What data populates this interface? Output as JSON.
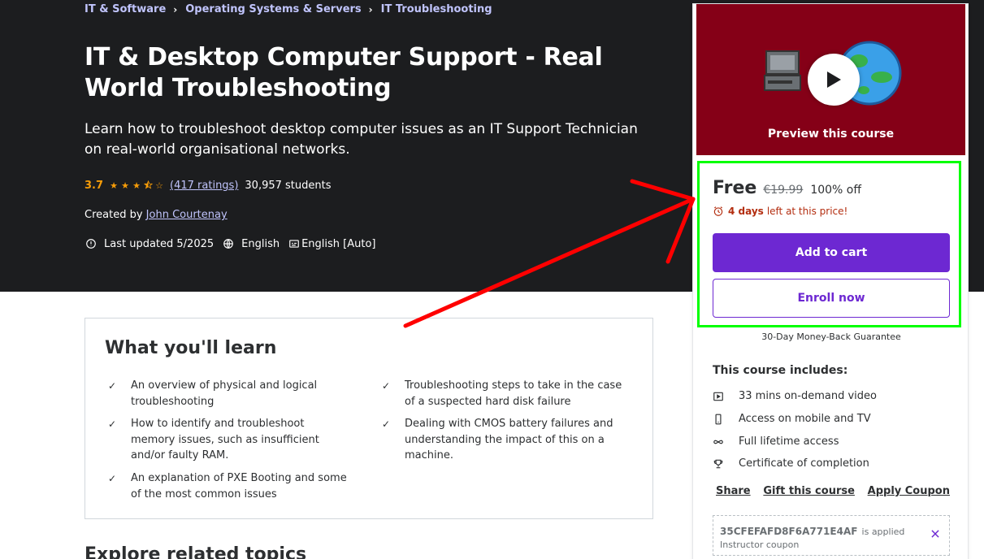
{
  "breadcrumb": {
    "items": [
      "IT & Software",
      "Operating Systems & Servers",
      "IT Troubleshooting"
    ],
    "separator": "›"
  },
  "course": {
    "title": "IT & Desktop Computer Support - Real World Troubleshooting",
    "subtitle": "Learn how to troubleshoot desktop computer issues as an IT Support Technician on real-world organisational networks.",
    "rating": "3.7",
    "rating_value": 3.7,
    "ratings_count": "(417 ratings)",
    "students": "30,957 students",
    "created_by_label": "Created by",
    "instructor": "John Courtenay",
    "last_updated": "Last updated 5/2025",
    "language": "English",
    "captions": "English [Auto]"
  },
  "learn": {
    "title": "What you'll learn",
    "items": [
      "An overview of physical and logical troubleshooting",
      "Troubleshooting steps to take in the case of a suspected hard disk failure",
      "How to identify and troubleshoot memory issues, such as insufficient and/or faulty RAM.",
      "Dealing with CMOS battery failures and understanding the impact of this on a machine.",
      "An explanation of PXE Booting and some of the most common issues"
    ]
  },
  "explore": {
    "title": "Explore related topics"
  },
  "sidebar": {
    "preview_label": "Preview this course",
    "price_free": "Free",
    "price_original": "€19.99",
    "price_off": "100% off",
    "deadline_days": "4 days",
    "deadline_rest": "left at this price!",
    "add_to_cart": "Add to cart",
    "enroll_now": "Enroll now",
    "guarantee": "30-Day Money-Back Guarantee",
    "includes_title": "This course includes:",
    "includes": [
      {
        "icon": "video-icon",
        "label": "33 mins on-demand video"
      },
      {
        "icon": "mobile-icon",
        "label": "Access on mobile and TV"
      },
      {
        "icon": "infinity-icon",
        "label": "Full lifetime access"
      },
      {
        "icon": "trophy-icon",
        "label": "Certificate of completion"
      }
    ],
    "links": [
      "Share",
      "Gift this course",
      "Apply Coupon"
    ],
    "coupon_code": "35CFEFAFD8F6A771E4AF",
    "coupon_applied": "is applied",
    "coupon_type": "Instructor coupon"
  },
  "colors": {
    "hero_bg": "#1c1d1f",
    "accent_purple": "#6d28d2",
    "link_lilac": "#c0c4fc",
    "star_orange": "#f69c08",
    "preview_bg": "#850017",
    "highlight_green": "#00ff00",
    "arrow_red": "#ff0000",
    "deadline_red": "#b32d0f"
  }
}
